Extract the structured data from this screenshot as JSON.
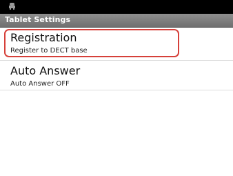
{
  "status_bar": {
    "icon": "android-icon"
  },
  "header": {
    "title": "Tablet Settings"
  },
  "settings": {
    "items": [
      {
        "title": "Registration",
        "summary": "Register to DECT base"
      },
      {
        "title": "Auto Answer",
        "summary": "Auto Answer OFF"
      }
    ]
  },
  "colors": {
    "status_bar": "#000000",
    "title_bar": "#7f7f7f",
    "highlight": "#d6403a",
    "background": "#ffffff"
  }
}
